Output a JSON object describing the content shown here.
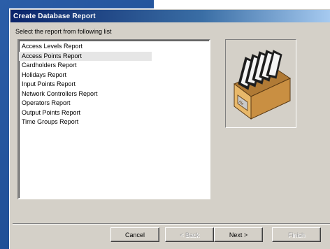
{
  "dialog": {
    "title": "Create Database Report",
    "instruction": "Select the report from following list"
  },
  "report_list": {
    "items": [
      "Access Levels Report",
      "Access Points Report",
      "Cardholders Report",
      "Holidays Report",
      "Input Points Report",
      "Network Controllers Report",
      "Operators Report",
      "Output Points Report",
      "Time Groups Report"
    ],
    "selected_index": 1
  },
  "illustration": {
    "icon": "card-file-box-icon",
    "box_label": "file"
  },
  "buttons": {
    "cancel": "Cancel",
    "back": "< Back",
    "next": "Next >",
    "finish": "Finish"
  },
  "colors": {
    "title_start": "#0a246a",
    "title_end": "#a6caf0",
    "dialog_face": "#d4d0c8",
    "desktop": "#27569c",
    "box_wood": "#d9a55a"
  }
}
